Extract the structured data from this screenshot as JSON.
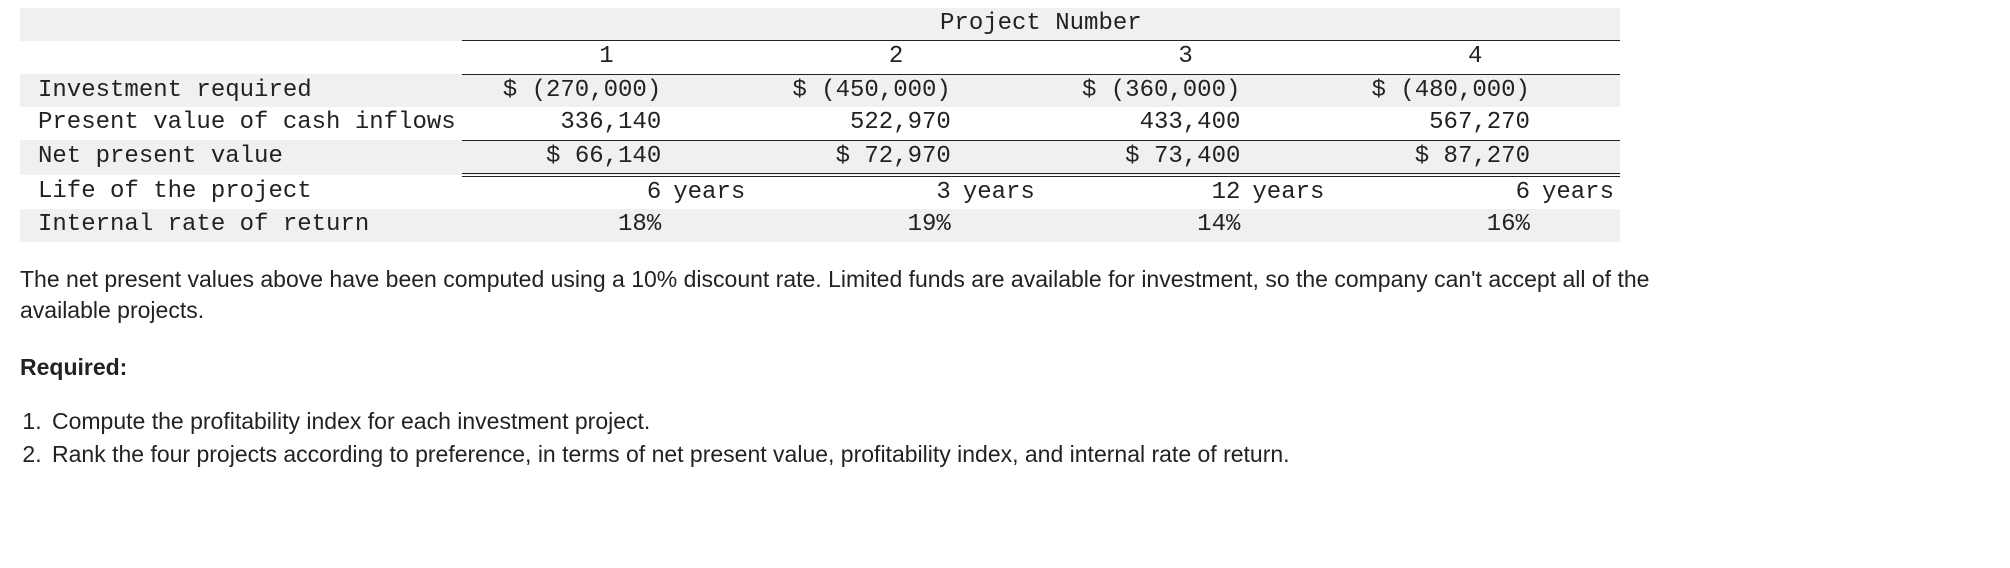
{
  "table": {
    "supertitle": "Project Number",
    "colheaders": [
      "1",
      "2",
      "3",
      "4"
    ],
    "rows": {
      "investment": {
        "label": "Investment required",
        "vals": [
          "$ (270,000)",
          "$ (450,000)",
          "$ (360,000)",
          "$ (480,000)"
        ]
      },
      "pvci": {
        "label": "Present value of cash inflows",
        "vals": [
          "336,140",
          "522,970",
          "433,400",
          "567,270"
        ]
      },
      "npv": {
        "label": "Net present value",
        "vals": [
          "$ 66,140",
          "$ 72,970",
          "$ 73,400",
          "$ 87,270"
        ]
      },
      "life": {
        "label": "Life of the project",
        "nums": [
          "6",
          "3",
          "12",
          "6"
        ],
        "unit": "years"
      },
      "irr": {
        "label": "Internal rate of return",
        "vals": [
          "18%",
          "19%",
          "14%",
          "16%"
        ]
      }
    }
  },
  "paragraph": "The net present values above have been computed using a 10% discount rate. Limited funds are available for investment, so the company can't accept all of the available projects.",
  "required_label": "Required:",
  "req1": "Compute the profitability index for each investment project.",
  "req2": "Rank the four projects according to preference, in terms of net present value, profitability index, and internal rate of return."
}
